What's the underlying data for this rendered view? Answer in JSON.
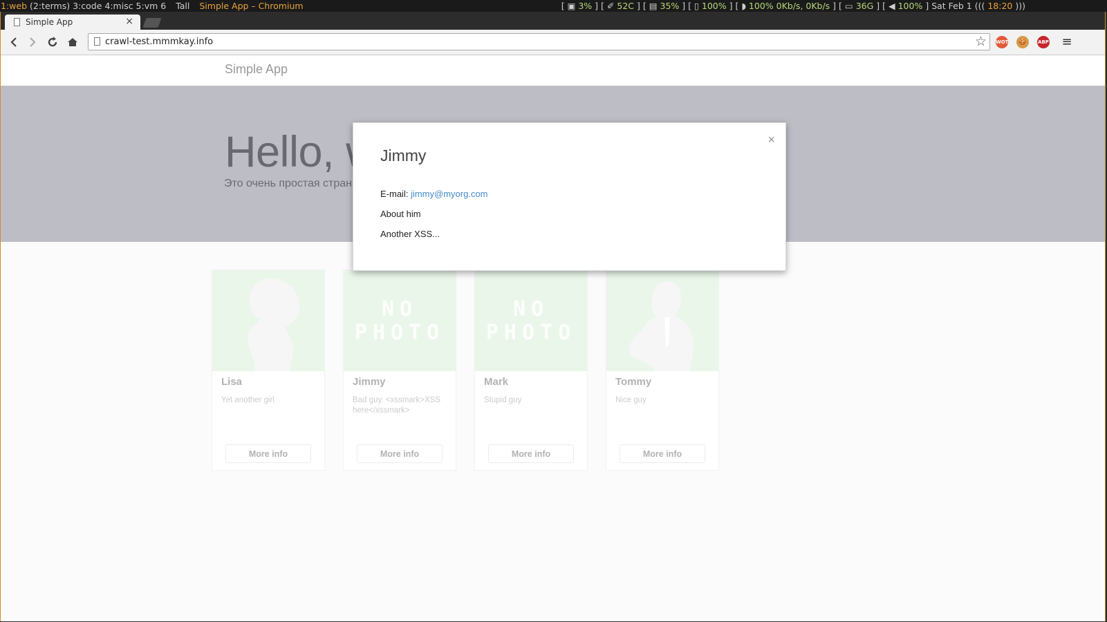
{
  "wm": {
    "ws1": "1:web",
    "ws_rest": "(2:terms) 3:code 4:misc 5:vm 6",
    "layout": "Tall",
    "window_title": "Simple App – Chromium",
    "stats": [
      {
        "open": "[ ",
        "icon": "▣",
        "value": "3%",
        "close": " ]"
      },
      {
        "open": "[ ",
        "icon": "✐",
        "value": "52C",
        "close": " ]"
      },
      {
        "open": "[ ",
        "icon": "▤",
        "value": "35%",
        "close": " ]"
      },
      {
        "open": "[ ",
        "icon": "▯",
        "value": "100%",
        "close": " ]"
      },
      {
        "open": "[ ",
        "icon": "◗",
        "value": "100% 0Kb/s, 0Kb/s",
        "close": " ]"
      },
      {
        "open": "[ ",
        "icon": "▭",
        "value": "36G",
        "close": " ]"
      },
      {
        "open": "[ ",
        "icon": "◀",
        "value": "100%",
        "close": " ]"
      }
    ],
    "date": "Sat Feb  1",
    "clock_open": "(((",
    "time": "18:20",
    "clock_close": ")))"
  },
  "browser": {
    "tab_title": "Simple App",
    "tab_close": "×",
    "url": "crawl-test.mmmkay.info",
    "star": "☆",
    "ext_wot": "WOT",
    "ext_cookie": "🍪",
    "ext_abp": "ABP",
    "menu": "≡"
  },
  "page": {
    "brand": "Simple App",
    "hero_title": "Hello, world!",
    "hero_subtitle": "Это очень простая страница",
    "cards": [
      {
        "name": "Lisa",
        "desc": "Yet another girl",
        "photo": "silhouette-woman",
        "button": "More info"
      },
      {
        "name": "Jimmy",
        "desc": "Bad guy. <xssmark>XSS here</xssmark>",
        "photo": "no-photo",
        "button": "More info"
      },
      {
        "name": "Mark",
        "desc": "Stupid guy",
        "photo": "no-photo",
        "button": "More info"
      },
      {
        "name": "Tommy",
        "desc": "Nice guy",
        "photo": "silhouette-man",
        "button": "More info"
      }
    ],
    "no_photo_text": [
      "NO",
      "PHOTO"
    ]
  },
  "modal": {
    "title": "Jimmy",
    "close": "×",
    "email_label": "E-mail:",
    "email": "jimmy@myorg.com",
    "about": "About him",
    "extra": "Another XSS..."
  },
  "colors": {
    "accent_wm": "#e8a33d",
    "link": "#428bca",
    "photo_bg": "#c8e6c9"
  }
}
